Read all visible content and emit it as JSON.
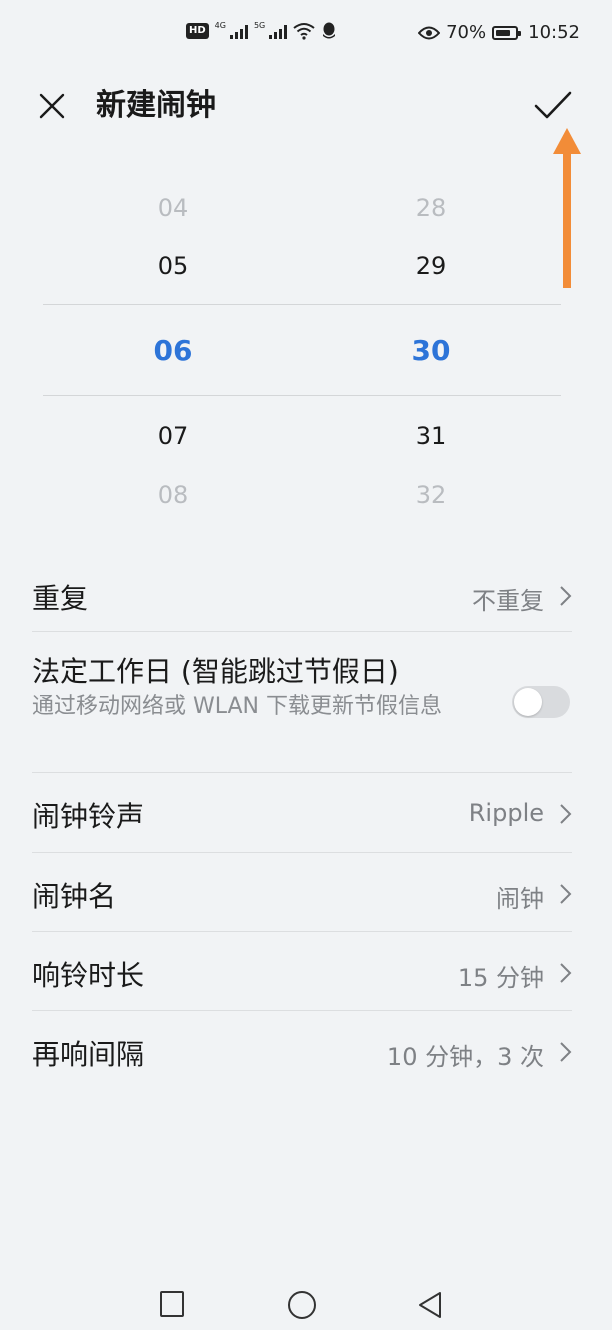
{
  "status_bar": {
    "hd_label": "HD",
    "network_1": "4G",
    "network_2": "5G",
    "battery": "70%",
    "time": "10:52"
  },
  "header": {
    "title": "新建闹钟",
    "close_icon": "close-icon",
    "confirm_icon": "check-icon"
  },
  "picker": {
    "hours": [
      "04",
      "05",
      "06",
      "07",
      "08"
    ],
    "minutes": [
      "28",
      "29",
      "30",
      "31",
      "32"
    ],
    "selected_color": "#2d74d8"
  },
  "settings": {
    "repeat": {
      "label": "重复",
      "value": "不重复"
    },
    "workday": {
      "label": "法定工作日 (智能跳过节假日)",
      "description": "通过移动网络或 WLAN 下载更新节假信息",
      "enabled": false
    },
    "ringtone": {
      "label": "闹钟铃声",
      "value": "Ripple"
    },
    "name": {
      "label": "闹钟名",
      "value": "闹钟"
    },
    "duration": {
      "label": "响铃时长",
      "value": "15 分钟"
    },
    "snooze": {
      "label": "再响间隔",
      "value": "10 分钟，3 次"
    }
  },
  "annotation": {
    "color": "#f28c38"
  },
  "nav": {
    "recent_icon": "square-icon",
    "home_icon": "circle-icon",
    "back_icon": "triangle-back-icon"
  }
}
